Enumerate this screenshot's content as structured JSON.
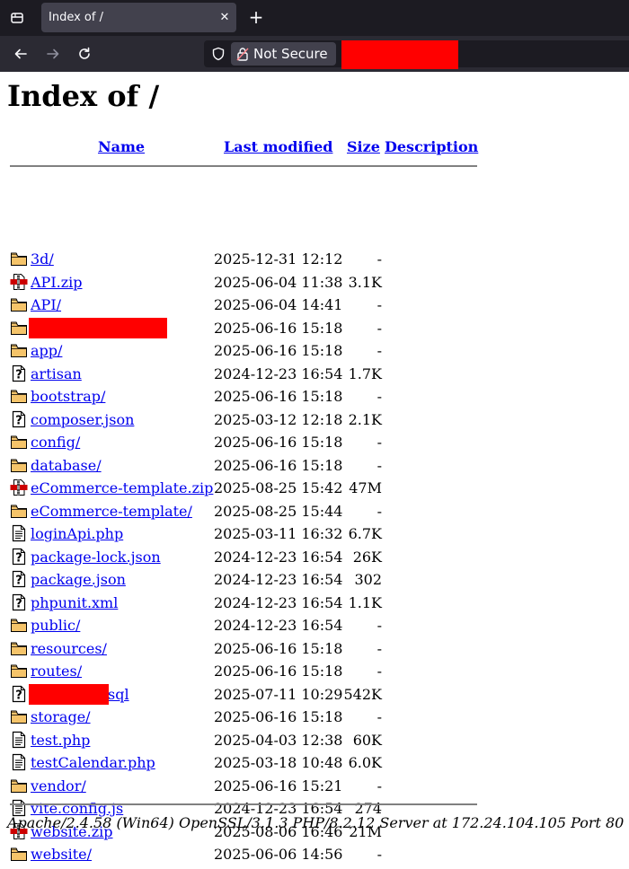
{
  "browser": {
    "tab_title": "Index of /",
    "tab_close": "✕",
    "new_tab": "+",
    "security_label": "Not Secure"
  },
  "page": {
    "title": "Index of /",
    "columns": {
      "name": "Name",
      "last_modified": "Last modified",
      "size": "Size",
      "description": "Description"
    },
    "rows": [
      {
        "icon": "folder-icon",
        "name": "3d/",
        "date": "2025-12-31 12:12",
        "size": "-"
      },
      {
        "icon": "compressed-file-icon",
        "name": "API.zip",
        "date": "2025-06-04 11:38",
        "size": "3.1K"
      },
      {
        "icon": "folder-icon",
        "name": "API/",
        "date": "2025-06-04 14:41",
        "size": "-"
      },
      {
        "icon": "folder-icon",
        "name": "",
        "date": "2025-06-16 15:18",
        "size": "-"
      },
      {
        "icon": "folder-icon",
        "name": "app/",
        "date": "2025-06-16 15:18",
        "size": "-"
      },
      {
        "icon": "unknown-file-icon",
        "name": "artisan",
        "date": "2024-12-23 16:54",
        "size": "1.7K"
      },
      {
        "icon": "folder-icon",
        "name": "bootstrap/",
        "date": "2025-06-16 15:18",
        "size": "-"
      },
      {
        "icon": "unknown-file-icon",
        "name": "composer.json",
        "date": "2025-03-12 12:18",
        "size": "2.1K"
      },
      {
        "icon": "folder-icon",
        "name": "config/",
        "date": "2025-06-16 15:18",
        "size": "-"
      },
      {
        "icon": "folder-icon",
        "name": "database/",
        "date": "2025-06-16 15:18",
        "size": "-"
      },
      {
        "icon": "compressed-file-icon",
        "name": "eCommerce-template.zip",
        "date": "2025-08-25 15:42",
        "size": "47M"
      },
      {
        "icon": "folder-icon",
        "name": "eCommerce-template/",
        "date": "2025-08-25 15:44",
        "size": "-"
      },
      {
        "icon": "text-file-icon",
        "name": "loginApi.php",
        "date": "2025-03-11 16:32",
        "size": "6.7K"
      },
      {
        "icon": "unknown-file-icon",
        "name": "package-lock.json",
        "date": "2024-12-23 16:54",
        "size": "26K"
      },
      {
        "icon": "unknown-file-icon",
        "name": "package.json",
        "date": "2024-12-23 16:54",
        "size": "302"
      },
      {
        "icon": "unknown-file-icon",
        "name": "phpunit.xml",
        "date": "2024-12-23 16:54",
        "size": "1.1K"
      },
      {
        "icon": "folder-icon",
        "name": "public/",
        "date": "2024-12-23 16:54",
        "size": "-"
      },
      {
        "icon": "folder-icon",
        "name": "resources/",
        "date": "2025-06-16 15:18",
        "size": "-"
      },
      {
        "icon": "folder-icon",
        "name": "routes/",
        "date": "2025-06-16 15:18",
        "size": "-"
      },
      {
        "icon": "unknown-file-icon",
        "name": "sql",
        "date": "2025-07-11 10:29",
        "size": "542K"
      },
      {
        "icon": "folder-icon",
        "name": "storage/",
        "date": "2025-06-16 15:18",
        "size": "-"
      },
      {
        "icon": "text-file-icon",
        "name": "test.php",
        "date": "2025-04-03 12:38",
        "size": "60K"
      },
      {
        "icon": "text-file-icon",
        "name": "testCalendar.php",
        "date": "2025-03-18 10:48",
        "size": "6.0K"
      },
      {
        "icon": "folder-icon",
        "name": "vendor/",
        "date": "2025-06-16 15:21",
        "size": "-"
      },
      {
        "icon": "text-file-icon",
        "name": "vite.config.js",
        "date": "2024-12-23 16:54",
        "size": "274"
      },
      {
        "icon": "compressed-file-icon",
        "name": "website.zip",
        "date": "2025-08-06 16:46",
        "size": "21M"
      },
      {
        "icon": "folder-icon",
        "name": "website/",
        "date": "2025-06-06 14:56",
        "size": "-"
      }
    ],
    "footer": "Apache/2.4.58 (Win64) OpenSSL/3.1.3 PHP/8.2.12 Server at 172.24.104.105 Port 80"
  },
  "colors": {
    "redaction": "#ff0000",
    "link": "#0000ee",
    "folder": "#f5c46a"
  }
}
